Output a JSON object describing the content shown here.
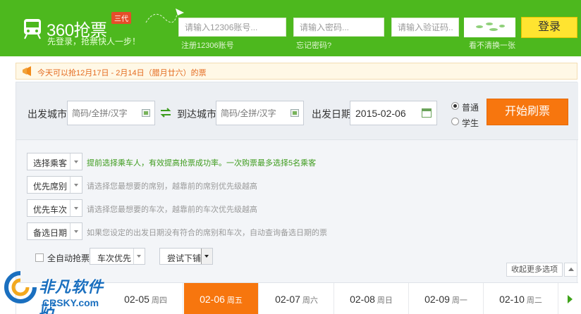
{
  "header": {
    "logo_title": "360抢票",
    "logo_badge": "三代",
    "slogan": "先登录，抢票快人一步！",
    "account_placeholder": "请输入12306账号...",
    "password_placeholder": "请输入密码...",
    "captcha_placeholder": "请输入验证码...",
    "register_link": "注册12306账号",
    "forgot_link": "忘记密码?",
    "captcha_refresh": "看不清换一张",
    "login_label": "登录"
  },
  "notice": {
    "text": "今天可以抢12月17日 - 2月14日（腊月廿六）的票"
  },
  "search": {
    "from_label": "出发城市",
    "from_placeholder": "简码/全拼/汉字",
    "to_label": "到达城市",
    "to_placeholder": "简码/全拼/汉字",
    "date_label": "出发日期",
    "date_value": "2015-02-06",
    "ticket_types": [
      {
        "label": "普通",
        "selected": true
      },
      {
        "label": "学生",
        "selected": false
      }
    ],
    "start_label": "开始刷票"
  },
  "options": [
    {
      "label": "选择乘客",
      "hint": "提前选择乘车人，有效提高抢票成功率。一次购票最多选择5名乘客"
    },
    {
      "label": "优先席别",
      "hint": "请选择您最想要的席别，越靠前的席别优先级越高"
    },
    {
      "label": "优先车次",
      "hint": "请选择您最想要的车次，越靠前的车次优先级越高"
    },
    {
      "label": "备选日期",
      "hint": "如果您设定的出发日期没有符合的席别和车次，自动查询备选日期的票"
    }
  ],
  "auto": {
    "checkbox_label": "全自动抢票",
    "priority_value": "车次优先",
    "fallback_value": "尝试下铺"
  },
  "more_options": "收起更多选项",
  "date_tabs": [
    {
      "date": "02-05",
      "week": "周四",
      "active": false
    },
    {
      "date": "02-06",
      "week": "周五",
      "active": true
    },
    {
      "date": "02-07",
      "week": "周六",
      "active": false
    },
    {
      "date": "02-08",
      "week": "周日",
      "active": false
    },
    {
      "date": "02-09",
      "week": "周一",
      "active": false
    },
    {
      "date": "02-10",
      "week": "周二",
      "active": false
    }
  ],
  "watermark": {
    "cn": "非凡软件站",
    "en": "CRSKY.com"
  },
  "colors": {
    "header_green": "#4db81e",
    "login_yellow": "#ffe430",
    "accent_orange": "#f7760e",
    "hint_green": "#3c9b1c"
  }
}
